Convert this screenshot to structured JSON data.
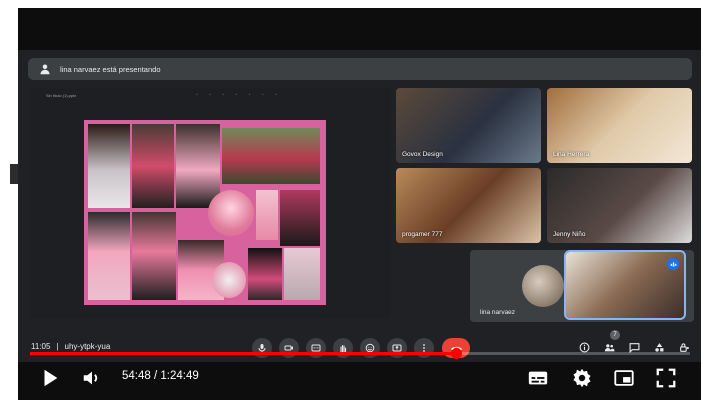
{
  "meet": {
    "presenting_banner": "lina narvaez está presentando",
    "meeting_time": "11:05",
    "separator": "|",
    "meeting_code": "uhy-ytpk-yua",
    "participants": [
      {
        "name": "Govox Design"
      },
      {
        "name": "Lina Herrera"
      },
      {
        "name": "progamer 777"
      },
      {
        "name": "Jenny Niño"
      }
    ],
    "self_tile_name": "lina narvaez",
    "participant_count_badge": "7",
    "slides_title": "Sin título (1).pptx"
  },
  "player": {
    "current_time": "54:48",
    "duration": "1:24:49",
    "time_separator": " / ",
    "progress": 0.646,
    "colors": {
      "progress": "#ff0000",
      "hangup": "#ea4335",
      "accent": "#1a73e8"
    }
  },
  "icons": {
    "play": "play-icon",
    "volume": "volume-icon",
    "subtitles": "subtitles-icon",
    "settings": "gear-icon",
    "miniplayer": "miniplayer-icon",
    "fullscreen": "fullscreen-icon"
  }
}
